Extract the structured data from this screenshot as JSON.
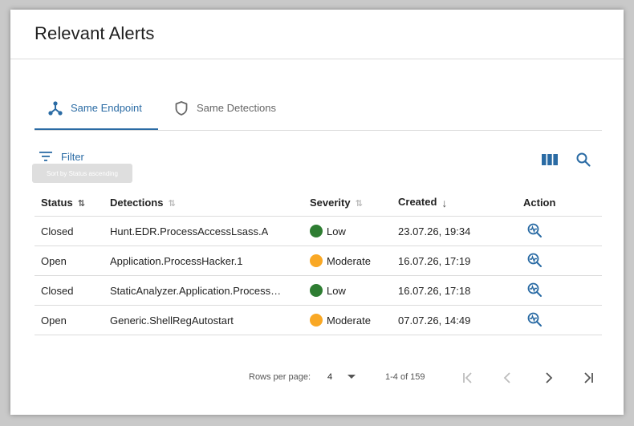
{
  "page": {
    "title": "Relevant Alerts"
  },
  "tabs": [
    {
      "label": "Same Endpoint",
      "icon": "endpoint-graph-icon",
      "active": true
    },
    {
      "label": "Same Detections",
      "icon": "shield-icon",
      "active": false
    }
  ],
  "toolbar": {
    "filter_label": "Filter",
    "tooltip": "Sort by Status ascending",
    "columns_icon": "view-columns-icon",
    "search_icon": "search-icon"
  },
  "table": {
    "headers": {
      "status": "Status",
      "detections": "Detections",
      "severity": "Severity",
      "created": "Created",
      "action": "Action"
    },
    "rows": [
      {
        "status": "Closed",
        "detection": "Hunt.EDR.ProcessAccessLsass.A",
        "severity": "Low",
        "severity_color": "#2e7d32",
        "created": "23.07.26, 19:34"
      },
      {
        "status": "Open",
        "detection": "Application.ProcessHacker.1",
        "severity": "Moderate",
        "severity_color": "#f9a825",
        "created": "16.07.26, 17:19"
      },
      {
        "status": "Closed",
        "detection": "StaticAnalyzer.Application.Process…",
        "severity": "Low",
        "severity_color": "#2e7d32",
        "created": "16.07.26, 17:18"
      },
      {
        "status": "Open",
        "detection": "Generic.ShellRegAutostart",
        "severity": "Moderate",
        "severity_color": "#f9a825",
        "created": "07.07.26, 14:49"
      }
    ]
  },
  "pagination": {
    "rows_per_page_label": "Rows per page:",
    "rows_per_page_value": "4",
    "range": "1-4 of 159"
  },
  "colors": {
    "accent": "#2a6ba4",
    "low": "#2e7d32",
    "moderate": "#f9a825"
  }
}
